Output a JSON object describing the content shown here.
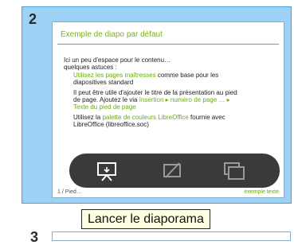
{
  "slide": {
    "number": "2",
    "title": "Exemple de diapo par défaut",
    "body": {
      "line1": "Ici un peu d'espace pour le contenu…",
      "line2": "quelques astuces :",
      "tip1a": "Utilisez les pages maîtresses",
      "tip1b": " comme base pour les",
      "tip1c": "diapositives standard",
      "tip2a": "Il peut être utile d'ajouter le titre de la présentation au pied",
      "tip2b": "de page. Ajoutez le via ",
      "tip2c": "Insertion ▸ numéro de page … ▸",
      "tip2d": "Texte du pied de page",
      "tip3a": "Utilisez la ",
      "tip3b": "palette de couleurs LibreOffice",
      "tip3c": " fournie avec",
      "tip3d": "LibreOffice (libreoffice.soc)"
    },
    "footer_left": "1 / Pied…",
    "footer_right": "exemple texte"
  },
  "toolbar": {
    "start_slideshow_icon": "presentation-screen-icon",
    "hide_slide_icon": "hide-slide-icon",
    "duplicate_slide_icon": "duplicate-slide-icon"
  },
  "tooltip": "Lancer le diaporama",
  "next_slide_number": "3",
  "colors": {
    "selection": "#9dd1f5",
    "accent_green": "#7ab317",
    "toolbar": "#3a3a3a",
    "tooltip_bg": "#ffffe1"
  }
}
